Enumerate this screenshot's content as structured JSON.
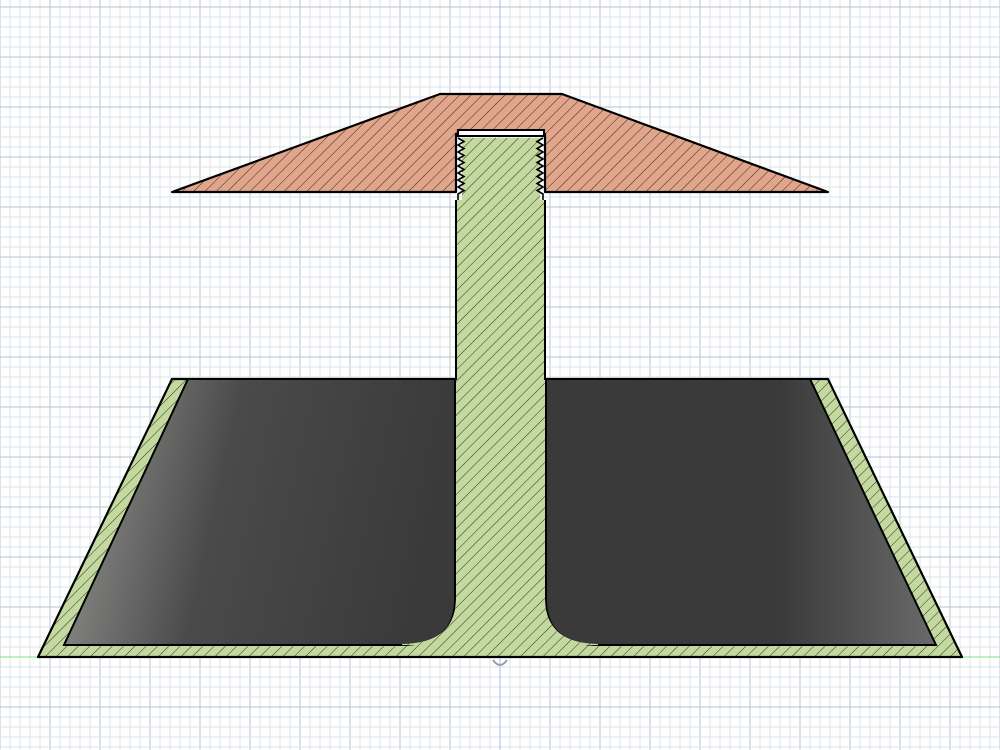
{
  "viewport": {
    "background_color": "#ffffff",
    "minor_grid_color": "#dde3ea",
    "major_grid_color": "#b9c3cf",
    "axis_vertical_color": "#a9b4ff",
    "axis_horizontal_color": "#7fe07f",
    "origin_marker_color": "#9aa0a6"
  },
  "section_view": {
    "cap": {
      "label": "cap-section",
      "fill_color": "#e0a58a",
      "hatch_color": "#3b2a20",
      "outline_color": "#000000"
    },
    "body": {
      "label": "funnel-body-section",
      "fill_color": "#c4d9a0",
      "hatch_color": "#2a3320",
      "outline_color": "#000000"
    },
    "cavity": {
      "label": "interior-cavity",
      "gradient_light": "#9a9a98",
      "gradient_mid": "#4a4a4a",
      "gradient_dark": "#3a3a3a"
    },
    "thread": {
      "label": "threaded-joint",
      "outline_color": "#000000"
    }
  }
}
